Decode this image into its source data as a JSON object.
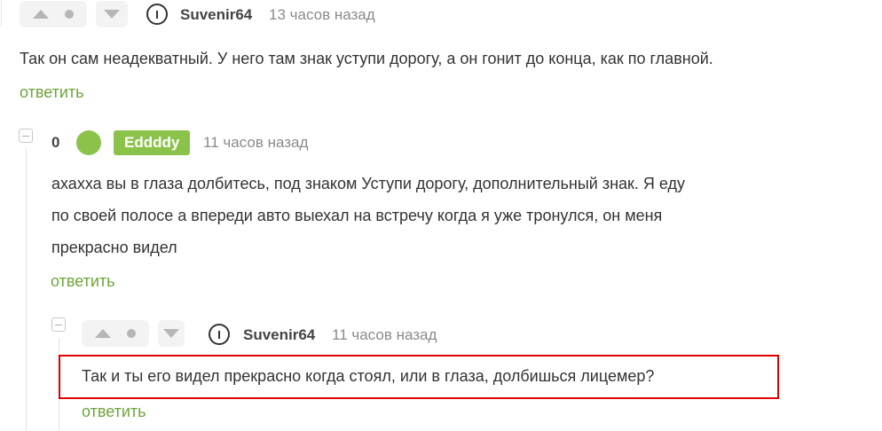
{
  "colors": {
    "accent_green": "#6fa33a",
    "badge_green": "#8bc34a",
    "highlight_red": "#e10000"
  },
  "comments": [
    {
      "author": "Suvenir64",
      "time": "13 часов назад",
      "text": "Так он сам неадекватный. У него там знак уступи дорогу, а он гонит до конца, как по главной.",
      "reply": "ответить"
    },
    {
      "rating": "0",
      "author": "Eddddy",
      "time": "11 часов назад",
      "text_lines": [
        "ахахха вы в глаза долбитесь, под знаком Уступи дорогу, дополнительный знак. Я еду",
        "по своей полосе а впереди авто выехал на встречу когда я уже тронулся, он меня",
        "прекрасно видел"
      ],
      "reply": "ответить"
    },
    {
      "author": "Suvenir64",
      "time": "11 часов назад",
      "text": "Так и ты его видел прекрасно когда стоял, или в глаза, долбишься лицемер?",
      "reply": "ответить"
    }
  ]
}
